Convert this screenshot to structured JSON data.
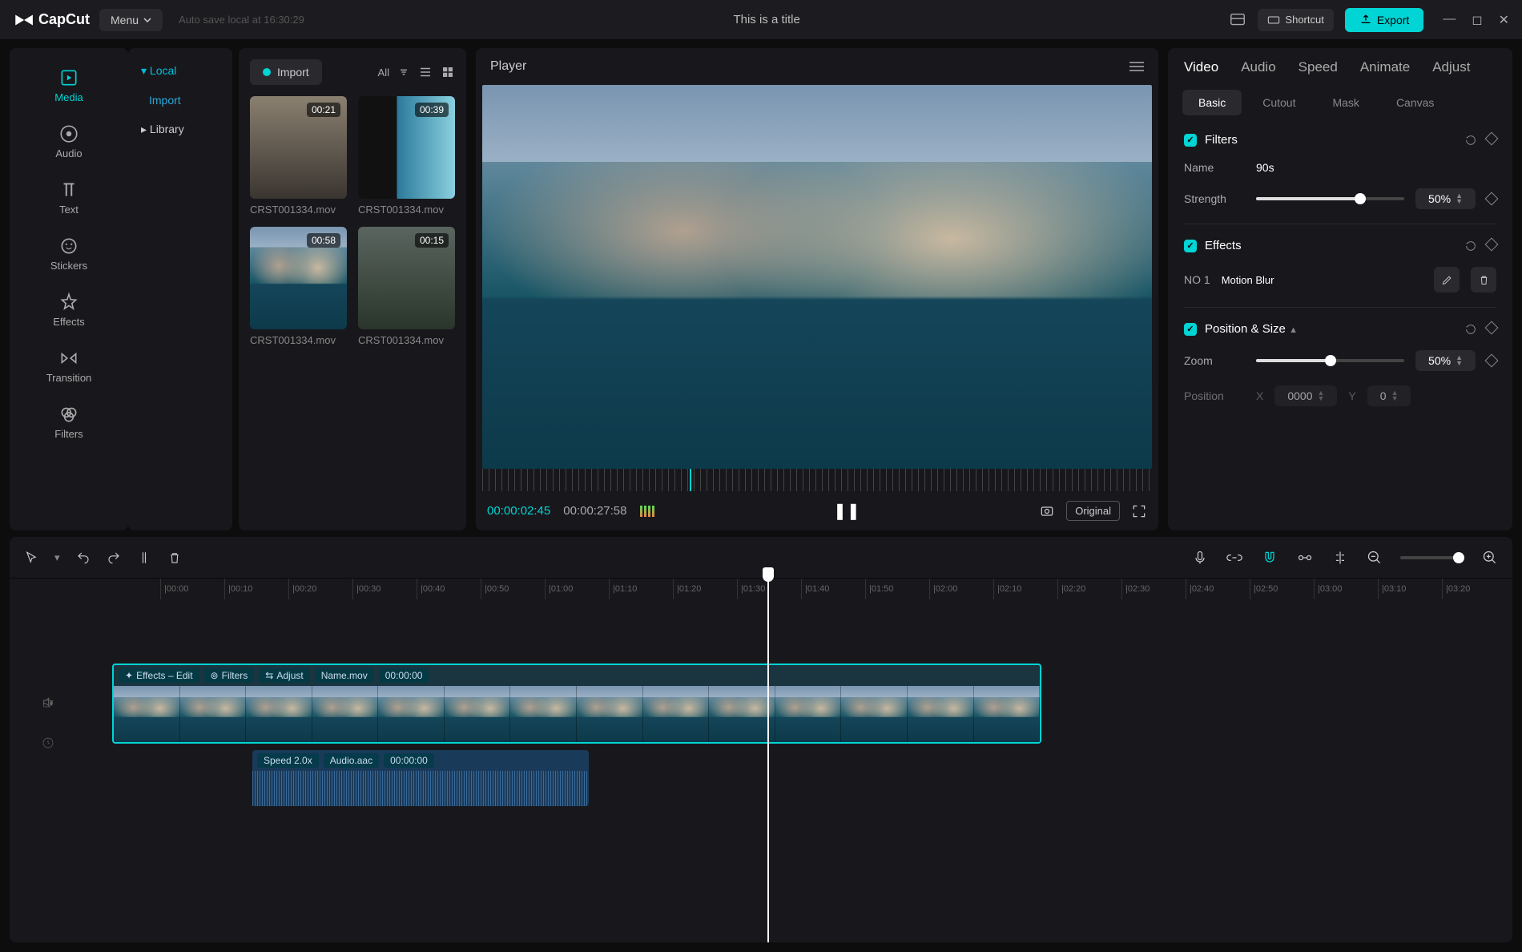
{
  "titlebar": {
    "brand": "CapCut",
    "menu": "Menu",
    "autosave": "Auto save local at 16:30:29",
    "title": "This is a title",
    "shortcut": "Shortcut",
    "export": "Export"
  },
  "toolstrip": {
    "media": "Media",
    "audio": "Audio",
    "text": "Text",
    "stickers": "Stickers",
    "effects": "Effects",
    "transition": "Transition",
    "filters": "Filters"
  },
  "sidetree": {
    "local": "Local",
    "import": "Import",
    "library": "Library"
  },
  "media": {
    "import": "Import",
    "all": "All",
    "clips": [
      {
        "duration": "00:21",
        "name": "CRST001334.mov"
      },
      {
        "duration": "00:39",
        "name": "CRST001334.mov"
      },
      {
        "duration": "00:58",
        "name": "CRST001334.mov"
      },
      {
        "duration": "00:15",
        "name": "CRST001334.mov"
      }
    ]
  },
  "player": {
    "title": "Player",
    "current": "00:00:02:45",
    "duration": "00:00:27:58",
    "original": "Original"
  },
  "inspector": {
    "tabs": {
      "video": "Video",
      "audio": "Audio",
      "speed": "Speed",
      "animate": "Animate",
      "adjust": "Adjust"
    },
    "subtabs": {
      "basic": "Basic",
      "cutout": "Cutout",
      "mask": "Mask",
      "canvas": "Canvas"
    },
    "filters": {
      "title": "Filters",
      "name_lbl": "Name",
      "name_val": "90s",
      "strength_lbl": "Strength",
      "strength_val": "50%"
    },
    "effects": {
      "title": "Effects",
      "no": "NO 1",
      "name": "Motion Blur"
    },
    "possize": {
      "title": "Position & Size",
      "zoom_lbl": "Zoom",
      "zoom_val": "50%",
      "position_lbl": "Position",
      "x_lbl": "X",
      "x_val": "0000",
      "y_lbl": "Y",
      "y_val": "0"
    }
  },
  "timeline": {
    "ticks": [
      "|00:00",
      "|00:10",
      "|00:20",
      "|00:30",
      "|00:40",
      "|00:50",
      "|01:00",
      "|01:10",
      "|01:20",
      "|01:30",
      "|01:40",
      "|01:50",
      "|02:00",
      "|02:10",
      "|02:20",
      "|02:30",
      "|02:40",
      "|02:50",
      "|03:00",
      "|03:10",
      "|03:20"
    ],
    "video": {
      "tags": {
        "effects": "Effects – Edit",
        "filters": "Filters",
        "adjust": "Adjust",
        "name": "Name.mov",
        "tc": "00:00:00"
      }
    },
    "audio": {
      "speed": "Speed 2.0x",
      "file": "Audio.aac",
      "tc": "00:00:00"
    }
  }
}
